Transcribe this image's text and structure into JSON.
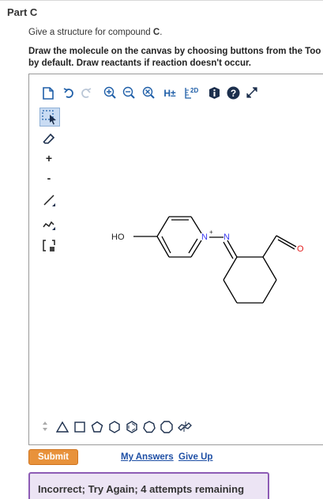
{
  "part": {
    "title": "Part C"
  },
  "question": {
    "prompt_prefix": "Give a structure for compound ",
    "prompt_compound": "C",
    "prompt_suffix": ".",
    "instruction_line1": "Draw the molecule on the canvas by choosing buttons from the Too",
    "instruction_line2": "by default. Draw reactants if reaction doesn't occur."
  },
  "toolbar": {
    "items": [
      {
        "name": "new-document-icon"
      },
      {
        "name": "undo-icon"
      },
      {
        "name": "redo-icon"
      },
      {
        "name": "zoom-in-icon"
      },
      {
        "name": "zoom-out-icon"
      },
      {
        "name": "clear-canvas-icon"
      },
      {
        "name": "hydrogen-toggle-icon",
        "label": "H±"
      },
      {
        "name": "clean-2d-icon",
        "label": "2D"
      },
      {
        "name": "info-icon"
      },
      {
        "name": "help-icon"
      },
      {
        "name": "fullscreen-icon"
      }
    ]
  },
  "side_tools": [
    {
      "name": "select-tool-icon"
    },
    {
      "name": "eraser-icon"
    },
    {
      "name": "positive-charge-icon",
      "label": "+"
    },
    {
      "name": "negative-charge-icon",
      "label": "-"
    },
    {
      "name": "single-bond-icon"
    },
    {
      "name": "chain-icon"
    },
    {
      "name": "template-bracket-icon"
    }
  ],
  "molecule": {
    "labels": {
      "hydroxyl": "HO",
      "pyridine_nitrogen": "N",
      "imine_nitrogen": "N",
      "aldehyde_oxygen": "O",
      "n_charge": "+"
    },
    "colors": {
      "bond": "#000000",
      "nitrogen": "#3a3af0",
      "oxygen": "#e21b1b",
      "plain": "#222222"
    }
  },
  "shape_bar": {
    "items": [
      {
        "name": "triangle-shape-icon"
      },
      {
        "name": "square-shape-icon"
      },
      {
        "name": "pentagon-shape-icon"
      },
      {
        "name": "hexagon-shape-icon"
      },
      {
        "name": "benzene-shape-icon"
      },
      {
        "name": "heptagon-shape-icon"
      },
      {
        "name": "octagon-shape-icon"
      },
      {
        "name": "chair-shape-icon"
      }
    ]
  },
  "actions": {
    "submit_label": "Submit",
    "my_answers_label": "My Answers",
    "give_up_label": "Give Up"
  },
  "feedback": {
    "message": "Incorrect; Try Again; 4 attempts remaining",
    "accent": "#8d5bb5",
    "background": "#ece4f4"
  },
  "colors": {
    "accent_button": "#e8923b",
    "link": "#1e4fa5",
    "select_highlight": "#c9dcf3"
  }
}
